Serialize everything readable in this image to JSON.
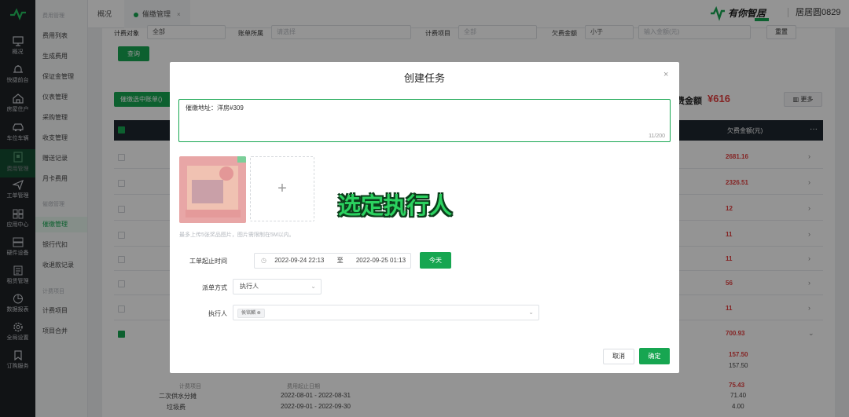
{
  "rail": {
    "items": [
      {
        "label": "概况",
        "icon": "monitor-icon"
      },
      {
        "label": "快捷前台",
        "icon": "bell-icon"
      },
      {
        "label": "房屋住户",
        "icon": "house-icon"
      },
      {
        "label": "车位车辆",
        "icon": "car-icon"
      },
      {
        "label": "费用管理",
        "icon": "bill-icon"
      },
      {
        "label": "工单管理",
        "icon": "send-icon"
      },
      {
        "label": "应用中心",
        "icon": "grid-icon"
      },
      {
        "label": "硬件设备",
        "icon": "device-icon"
      },
      {
        "label": "租赁管理",
        "icon": "document-icon"
      },
      {
        "label": "数据报表",
        "icon": "chart-icon"
      },
      {
        "label": "全局设置",
        "icon": "gear-icon"
      },
      {
        "label": "订购服务",
        "icon": "bookmark-icon"
      }
    ]
  },
  "menu": {
    "group1": "费用管理",
    "items1": [
      "费用列表",
      "生成费用",
      "保证金管理",
      "仪表管理",
      "采购管理",
      "收支管理",
      "赠送记录",
      "月卡费用"
    ],
    "group2": "催缴管理",
    "items2": [
      "催缴管理",
      "银行代扣",
      "收退款记录"
    ],
    "group3": "计费项目",
    "items3": [
      "计费项目",
      "项目合并"
    ]
  },
  "tabs": [
    {
      "label": "概况"
    },
    {
      "label": "催缴管理"
    }
  ],
  "user": {
    "name": "居居圆0829"
  },
  "brand": {
    "name": "有你智居",
    "accent": "#17a651"
  },
  "filters": {
    "target_label": "计费对象",
    "target_value": "全部",
    "bill_label": "账单所属",
    "bill_placeholder": "请选择",
    "project_label": "计费项目",
    "project_value": "全部",
    "arrears_label": "欠费金额",
    "compare_value": "小于",
    "amount_placeholder": "输入金额(元)",
    "reset": "重置",
    "query": "查询"
  },
  "toolbar": {
    "batch": "催缴选中账单()",
    "total_label": "费金额",
    "total_value": "¥616",
    "more": "更多"
  },
  "table": {
    "header_amount": "欠费金额(元)",
    "amounts": [
      "2681.16",
      "2326.51",
      "12",
      "11",
      "11",
      "56",
      "11",
      "700.93"
    ],
    "sub_amounts": [
      "157.50",
      "157.50",
      "75.43",
      "71.40",
      "4.00"
    ],
    "sub_header": "计费项目",
    "sub_header2": "费用起止日期",
    "sub_items": [
      "二次供水分摊",
      "垃圾费"
    ],
    "sub_dates": [
      "2022-08-01 - 2022-08-31",
      "2022-09-01 - 2022-09-30"
    ]
  },
  "modal": {
    "title": "创建任务",
    "textarea_value": "催缴地址：洋房#309",
    "char_count": "11/200",
    "upload_hint": "最多上传5张奖品图片，图片需限制在5M以内。",
    "overlay_caption": "选定执行人",
    "time_label": "工单起止时间",
    "time_start": "2022-09-24 22:13",
    "time_sep": "至",
    "time_end": "2022-09-25 01:13",
    "today": "今天",
    "dispatch_label": "派单方式",
    "dispatch_value": "执行人",
    "executor_label": "执行人",
    "executor_tag": "侯铭麟",
    "cancel": "取消",
    "confirm": "确定"
  }
}
